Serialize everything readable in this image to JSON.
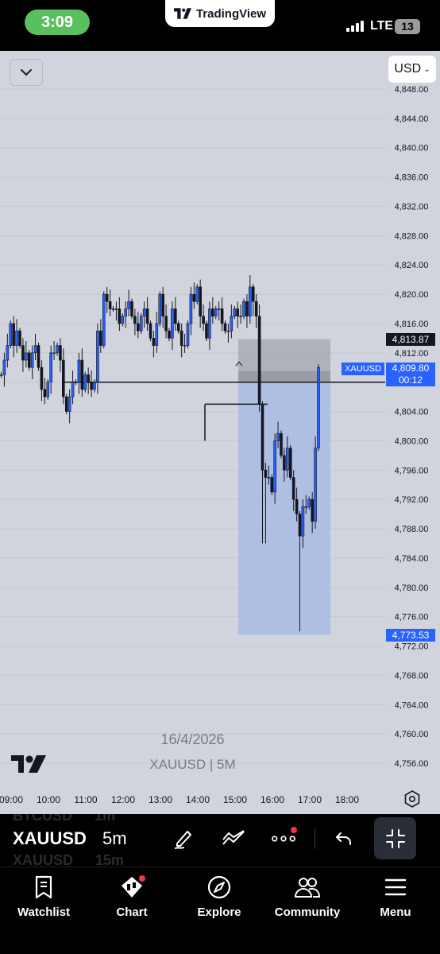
{
  "status_bar": {
    "time": "3:09",
    "app_banner": "TradingView",
    "network": "LTE",
    "battery": "13"
  },
  "chart": {
    "currency": "USD",
    "date_label": "16/4/2026",
    "symbol_label": "XAUUSD | 5M",
    "price_axis": [
      "4,848.00",
      "4,844.00",
      "4,840.00",
      "4,836.00",
      "4,832.00",
      "4,828.00",
      "4,824.00",
      "4,820.00",
      "4,816.00",
      "4,812.00",
      "4,808.00",
      "4,804.00",
      "4,800.00",
      "4,796.00",
      "4,792.00",
      "4,788.00",
      "4,784.00",
      "4,780.00",
      "4,776.00",
      "4,772.00",
      "4,768.00",
      "4,764.00",
      "4,760.00",
      "4,756.00"
    ],
    "time_axis": [
      "09:00",
      "10:00",
      "11:00",
      "12:00",
      "13:00",
      "14:00",
      "15:00",
      "16:00",
      "17:00",
      "18:00"
    ],
    "tags": {
      "target_price": "4,813.87",
      "symbol": "XAUUSD",
      "last_price": "4,809.80",
      "countdown": "00:12",
      "stop_price": "4,773.53"
    },
    "colors": {
      "background": "#d1d4dc",
      "candle": "#131722",
      "reward_zone": "#a6b9e3",
      "risk_zone": "#a9abb2",
      "accent": "#2962ff"
    }
  },
  "chart_data": {
    "type": "candlestick",
    "ylim": [
      4754,
      4849
    ],
    "x": [
      "09:00",
      "10:00",
      "11:00",
      "12:00",
      "13:00",
      "14:00",
      "15:00",
      "16:00",
      "17:00",
      "18:00"
    ],
    "closes": [
      4809,
      4811,
      4813,
      4816,
      4813,
      4815,
      4813,
      4811,
      4812,
      4810,
      4812,
      4813,
      4810,
      4807,
      4806,
      4808,
      4812,
      4812,
      4813,
      4811,
      4806,
      4804,
      4806,
      4808,
      4808,
      4811,
      4807,
      4809,
      4808,
      4807,
      4808,
      4815,
      4813,
      4820,
      4819,
      4818,
      4818,
      4818,
      4816,
      4817,
      4818,
      4819,
      4817,
      4816,
      4815,
      4817,
      4818,
      4816,
      4814,
      4813,
      4816,
      4820,
      4817,
      4815,
      4814,
      4818,
      4816,
      4815,
      4813,
      4813,
      4816,
      4820,
      4819,
      4821,
      4817,
      4816,
      4814,
      4818,
      4817,
      4818,
      4818,
      4816,
      4815,
      4815,
      4817,
      4818,
      4817,
      4817,
      4819,
      4817,
      4821,
      4819,
      4817,
      4805,
      4796,
      4795,
      4795,
      4793,
      4800,
      4801,
      4798,
      4796,
      4799,
      4795,
      4792,
      4790,
      4787,
      4791,
      4791,
      4792,
      4789,
      4799,
      4810
    ],
    "series": [
      {
        "name": "XAUUSD",
        "last": 4809.8
      }
    ],
    "position": {
      "entry": 4808.0,
      "target": 4813.87,
      "stop": 4773.53
    },
    "horizontal_lines": [
      4808.0,
      4805.0
    ]
  },
  "toolbar": {
    "symbol": "XAUUSD",
    "interval": "5m",
    "ghost_above": {
      "symbol": "BTCUSD",
      "interval": "1m"
    },
    "ghost_below": {
      "symbol": "XAUUSD",
      "interval": "15m"
    }
  },
  "tabs": [
    {
      "label": "Watchlist",
      "icon": "bookmark-icon"
    },
    {
      "label": "Chart",
      "icon": "chart-candles-icon"
    },
    {
      "label": "Explore",
      "icon": "compass-icon"
    },
    {
      "label": "Community",
      "icon": "people-icon"
    },
    {
      "label": "Menu",
      "icon": "hamburger-icon"
    }
  ]
}
